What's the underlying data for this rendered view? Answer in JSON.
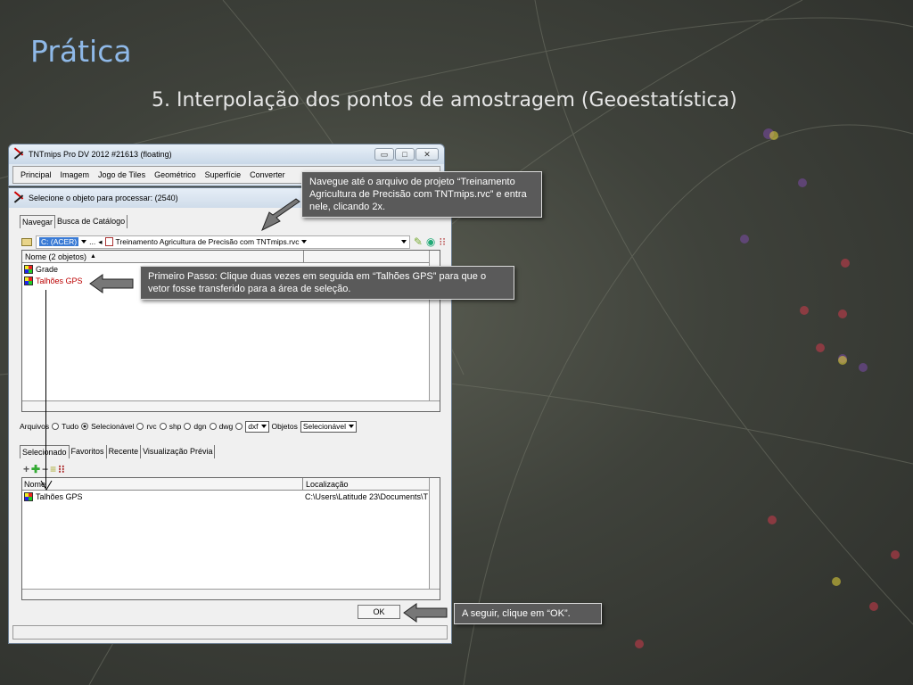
{
  "slide": {
    "title": "Prática",
    "subtitle": "5. Interpolação dos pontos de amostragem (Geoestatística)"
  },
  "main_window": {
    "title": "TNTmips Pro DV 2012  #21613 (floating)",
    "menu": [
      "Principal",
      "Imagem",
      "Jogo de Tiles",
      "Geométrico",
      "Superfície",
      "Converter"
    ]
  },
  "dialog": {
    "title": "Selecione o objeto para processar: (2540)",
    "top_tabs": [
      "Navegar",
      "Busca de Catálogo"
    ],
    "path": {
      "drive": "C: (ACER)",
      "ellipsis": "...",
      "project": "Treinamento Agricultura de Precisão com TNTmips.rvc"
    },
    "browse_list": {
      "header": "Nome  (2 objetos)",
      "items": [
        "Grade",
        "Talhões GPS"
      ]
    },
    "filter": {
      "files_label": "Arquivos",
      "options": [
        "Tudo",
        "Selecionável",
        "rvc",
        "shp",
        "dgn",
        "dwg"
      ],
      "selected_option": "Selecionável",
      "ext_value": "dxf",
      "objects_label": "Objetos",
      "objects_value": "Selecionável"
    },
    "bottom_tabs": [
      "Selecionado",
      "Favoritos",
      "Recente",
      "Visualização Prévia"
    ],
    "selected_list": {
      "col_name": "Nome",
      "col_location": "Localização",
      "rows": [
        {
          "name": "Talhões GPS",
          "location": "C:\\Users\\Latitude 23\\Documents\\T"
        }
      ]
    },
    "ok_label": "OK"
  },
  "callouts": {
    "navigate": "Navegue até o arquivo de projeto “Treinamento Agricultura de Precisão com TNTmips.rvc” e entra nele, clicando 2x.",
    "first_step": "Primeiro Passo: Clique duas vezes em seguida em “Talhões GPS” para que o vetor fosse transferido para a área de seleção.",
    "ok_step": "A seguir, clique em “OK”."
  },
  "colors": {
    "title_blue": "#8fb9e8",
    "callout_bg": "#5a5a5a"
  }
}
